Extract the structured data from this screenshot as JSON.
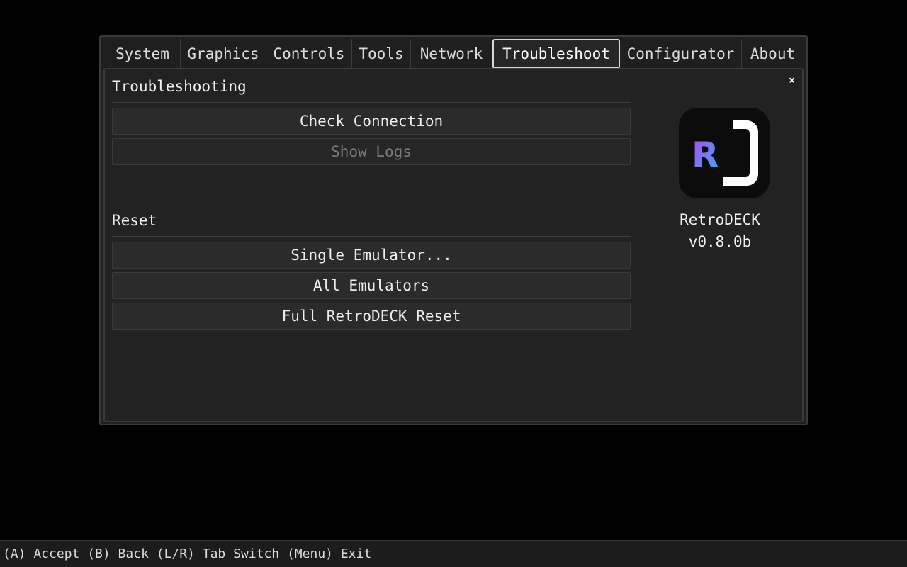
{
  "tabs": [
    {
      "label": "System"
    },
    {
      "label": "Graphics"
    },
    {
      "label": "Controls"
    },
    {
      "label": "Tools"
    },
    {
      "label": "Network"
    },
    {
      "label": "Troubleshoot",
      "active": true
    },
    {
      "label": "Configurator"
    },
    {
      "label": "About"
    }
  ],
  "close_label": "×",
  "troubleshooting": {
    "title": "Troubleshooting",
    "check_connection": "Check Connection",
    "show_logs": "Show Logs"
  },
  "reset": {
    "title": "Reset",
    "single_emulator": "Single Emulator...",
    "all_emulators": "All Emulators",
    "full_reset": "Full RetroDECK Reset"
  },
  "app": {
    "name": "RetroDECK",
    "version": "v0.8.0b",
    "logo_icon": "retrodeck-logo-icon"
  },
  "footer": {
    "hint": "(A) Accept (B) Back (L/R) Tab Switch (Menu) Exit"
  },
  "colors": {
    "background": "#000000",
    "panel": "#222222",
    "button": "#2b2b2b",
    "active_tab_border": "#d8d8d8",
    "disabled_text": "#7a7a7a"
  }
}
